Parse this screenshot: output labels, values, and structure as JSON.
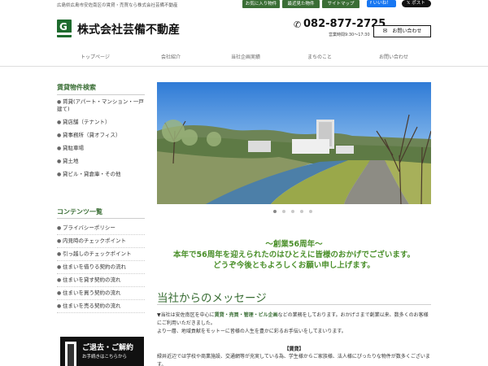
{
  "header": {
    "tagline": "広島県広島市安佐南区の賃貸・売買なら株式会社芸備不動産",
    "top_links": [
      "お気に入り物件",
      "最近見た物件",
      "サイトマップ"
    ],
    "facebook_label": "いいね！",
    "x_label": "ポスト",
    "logo_letter": "G",
    "company_name": "株式会社芸備不動産",
    "phone": "082-877-2725",
    "hours": "営業時間9:30～17:30",
    "contact_label": "お問い合わせ"
  },
  "nav": [
    "トップページ",
    "会社紹介",
    "当社企画実績",
    "まちのこと",
    "お問い合わせ"
  ],
  "sidebar": {
    "search_heading": "賃貸物件検索",
    "search_items": [
      "賃貸(アパート・マンション・一戸建て)",
      "貸店舗（テナント）",
      "貸事務所（貸オフィス）",
      "貸駐車場",
      "貸土地",
      "貸ビル・貸倉庫・その他"
    ],
    "content_heading": "コンテンツ一覧",
    "content_items": [
      "プライバシーポリシー",
      "内見時のチェックポイント",
      "引っ越しのチェックポイント",
      "住まいを借りる契約の流れ",
      "住まいを貸す契約の流れ",
      "住まいを買う契約の流れ",
      "住まいを売る契約の流れ"
    ],
    "banner_title": "ご退去・ご解約",
    "banner_sub": "お手続きはこちらから"
  },
  "slider": {
    "dot_count": 5,
    "active_index": 0
  },
  "message": {
    "anniv_line1": "～創業56周年～",
    "anniv_line2": "本年で56周年を迎えられたのはひとえに皆様のおかげでございます。",
    "anniv_line3": "どうぞ今後ともよろしくお願い申し上げます。",
    "title": "当社からのメッセージ",
    "p1_pre": "▼当社は安佐南区を中心に",
    "p1_highlight": "賃貸・売買・管理・ビル企画",
    "p1_post": "などの業務をしております。おかげさまで創業以来、数多くのお客様にご利用いただきました。",
    "p2": "より一層、地域貢献をモットーに皆様の人生を豊かに彩るお手伝いをしてまいります。",
    "sub_heading": "【賃貸】",
    "p3": "緑井近辺では学校や商業施設、交通網等が充実している為、学生様からご家族様、法人様にぴったりな物件が数多くございます。"
  },
  "colors": {
    "accent_green": "#3a6e35",
    "anniv_green": "#4a8f2a",
    "logo_green": "#1e6b2e"
  }
}
